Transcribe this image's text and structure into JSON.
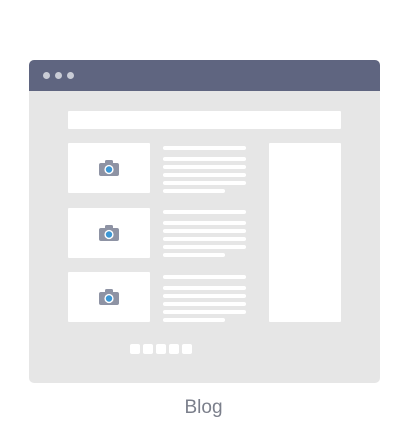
{
  "caption": "Blog",
  "icons": {
    "window_controls": [
      "window-dot-icon",
      "window-dot-icon",
      "window-dot-icon"
    ],
    "post_thumbnail": "camera-icon"
  },
  "colors": {
    "titlebar": "#5f6580",
    "window_background": "#e6e6e6",
    "placeholder": "#ffffff",
    "camera_body": "#8e93a4",
    "camera_lens": "#3d97d4",
    "caption_text": "#7b7f8b"
  },
  "posts_count": 3,
  "pagination_count": 5
}
